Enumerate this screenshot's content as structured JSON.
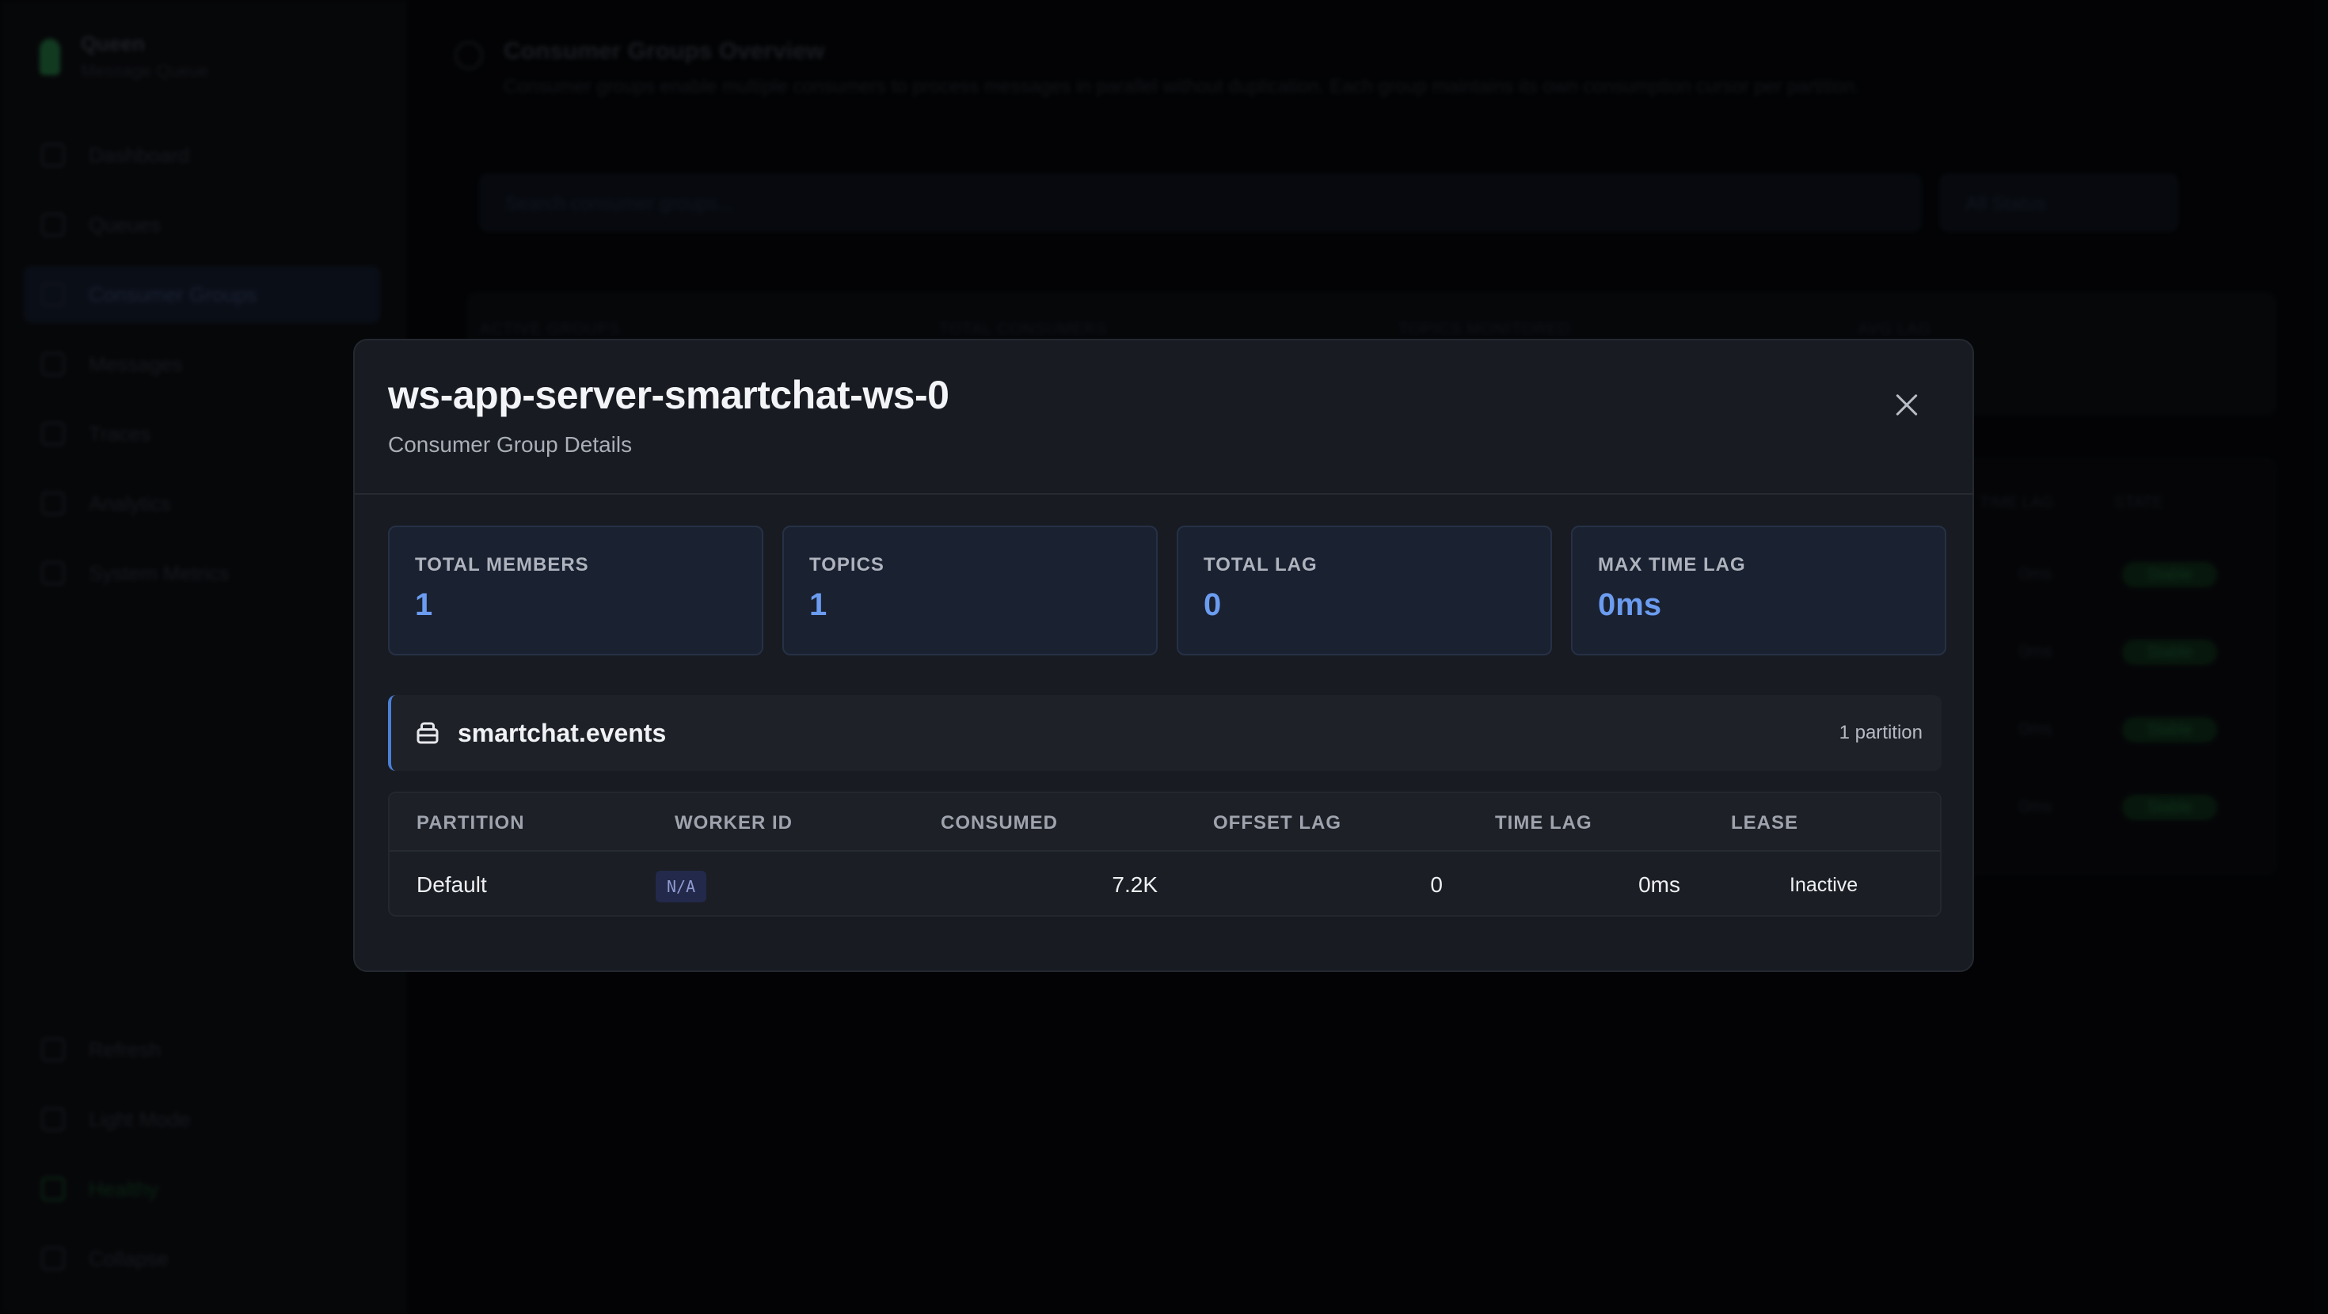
{
  "sidebar": {
    "brand": {
      "name": "Queen",
      "subtitle": "Message Queue"
    },
    "nav": [
      {
        "label": "Dashboard",
        "icon": "grid-icon"
      },
      {
        "label": "Queues",
        "icon": "queue-icon"
      },
      {
        "label": "Consumer Groups",
        "icon": "users-icon",
        "active": true
      },
      {
        "label": "Messages",
        "icon": "mail-icon"
      },
      {
        "label": "Traces",
        "icon": "trace-icon"
      },
      {
        "label": "Analytics",
        "icon": "chart-icon"
      },
      {
        "label": "System Metrics",
        "icon": "metrics-icon"
      }
    ],
    "bottom": [
      {
        "label": "Refresh",
        "icon": "refresh-icon"
      },
      {
        "label": "Light Mode",
        "icon": "sun-icon"
      },
      {
        "label": "Healthy",
        "icon": "heart-icon"
      },
      {
        "label": "Collapse",
        "icon": "collapse-icon"
      }
    ]
  },
  "main": {
    "title": "Consumer Groups Overview",
    "description": "Consumer groups enable multiple consumers to process messages in parallel without duplication. Each group maintains its own consumption cursor per partition.",
    "search_placeholder": "Search consumer groups...",
    "status_filter": "All Status",
    "stats_labels": [
      "ACTIVE GROUPS",
      "TOTAL CONSUMERS",
      "TOPICS MONITORED",
      "AVG LAG"
    ],
    "table_headers": [
      "TIME LAG",
      "STATE"
    ],
    "rows": [
      {
        "time_lag": "0ms",
        "state": "Stable"
      },
      {
        "time_lag": "0ms",
        "state": "Stable"
      },
      {
        "time_lag": "0ms",
        "state": "Stable"
      },
      {
        "time_lag": "0ms",
        "state": "Stable"
      }
    ]
  },
  "modal": {
    "title": "ws-app-server-smartchat-ws-0",
    "subtitle": "Consumer Group Details",
    "stats": [
      {
        "label": "TOTAL MEMBERS",
        "value": "1"
      },
      {
        "label": "TOPICS",
        "value": "1"
      },
      {
        "label": "TOTAL LAG",
        "value": "0"
      },
      {
        "label": "MAX TIME LAG",
        "value": "0ms"
      }
    ],
    "topic": {
      "name": "smartchat.events",
      "partitions": "1 partition",
      "icon": "database-icon"
    },
    "partition_table": {
      "headers": [
        "PARTITION",
        "WORKER ID",
        "CONSUMED",
        "OFFSET LAG",
        "TIME LAG",
        "LEASE"
      ],
      "rows": [
        {
          "partition": "Default",
          "worker_id": "N/A",
          "consumed": "7.2K",
          "offset_lag": "0",
          "time_lag": "0ms",
          "lease": "Inactive"
        }
      ]
    }
  },
  "colors": {
    "accent": "#6b9cf0",
    "topic_border": "#4a7fd6",
    "modal_bg": "#181b21",
    "stat_card_bg": "#1a2131",
    "healthy": "#1d5a34"
  }
}
